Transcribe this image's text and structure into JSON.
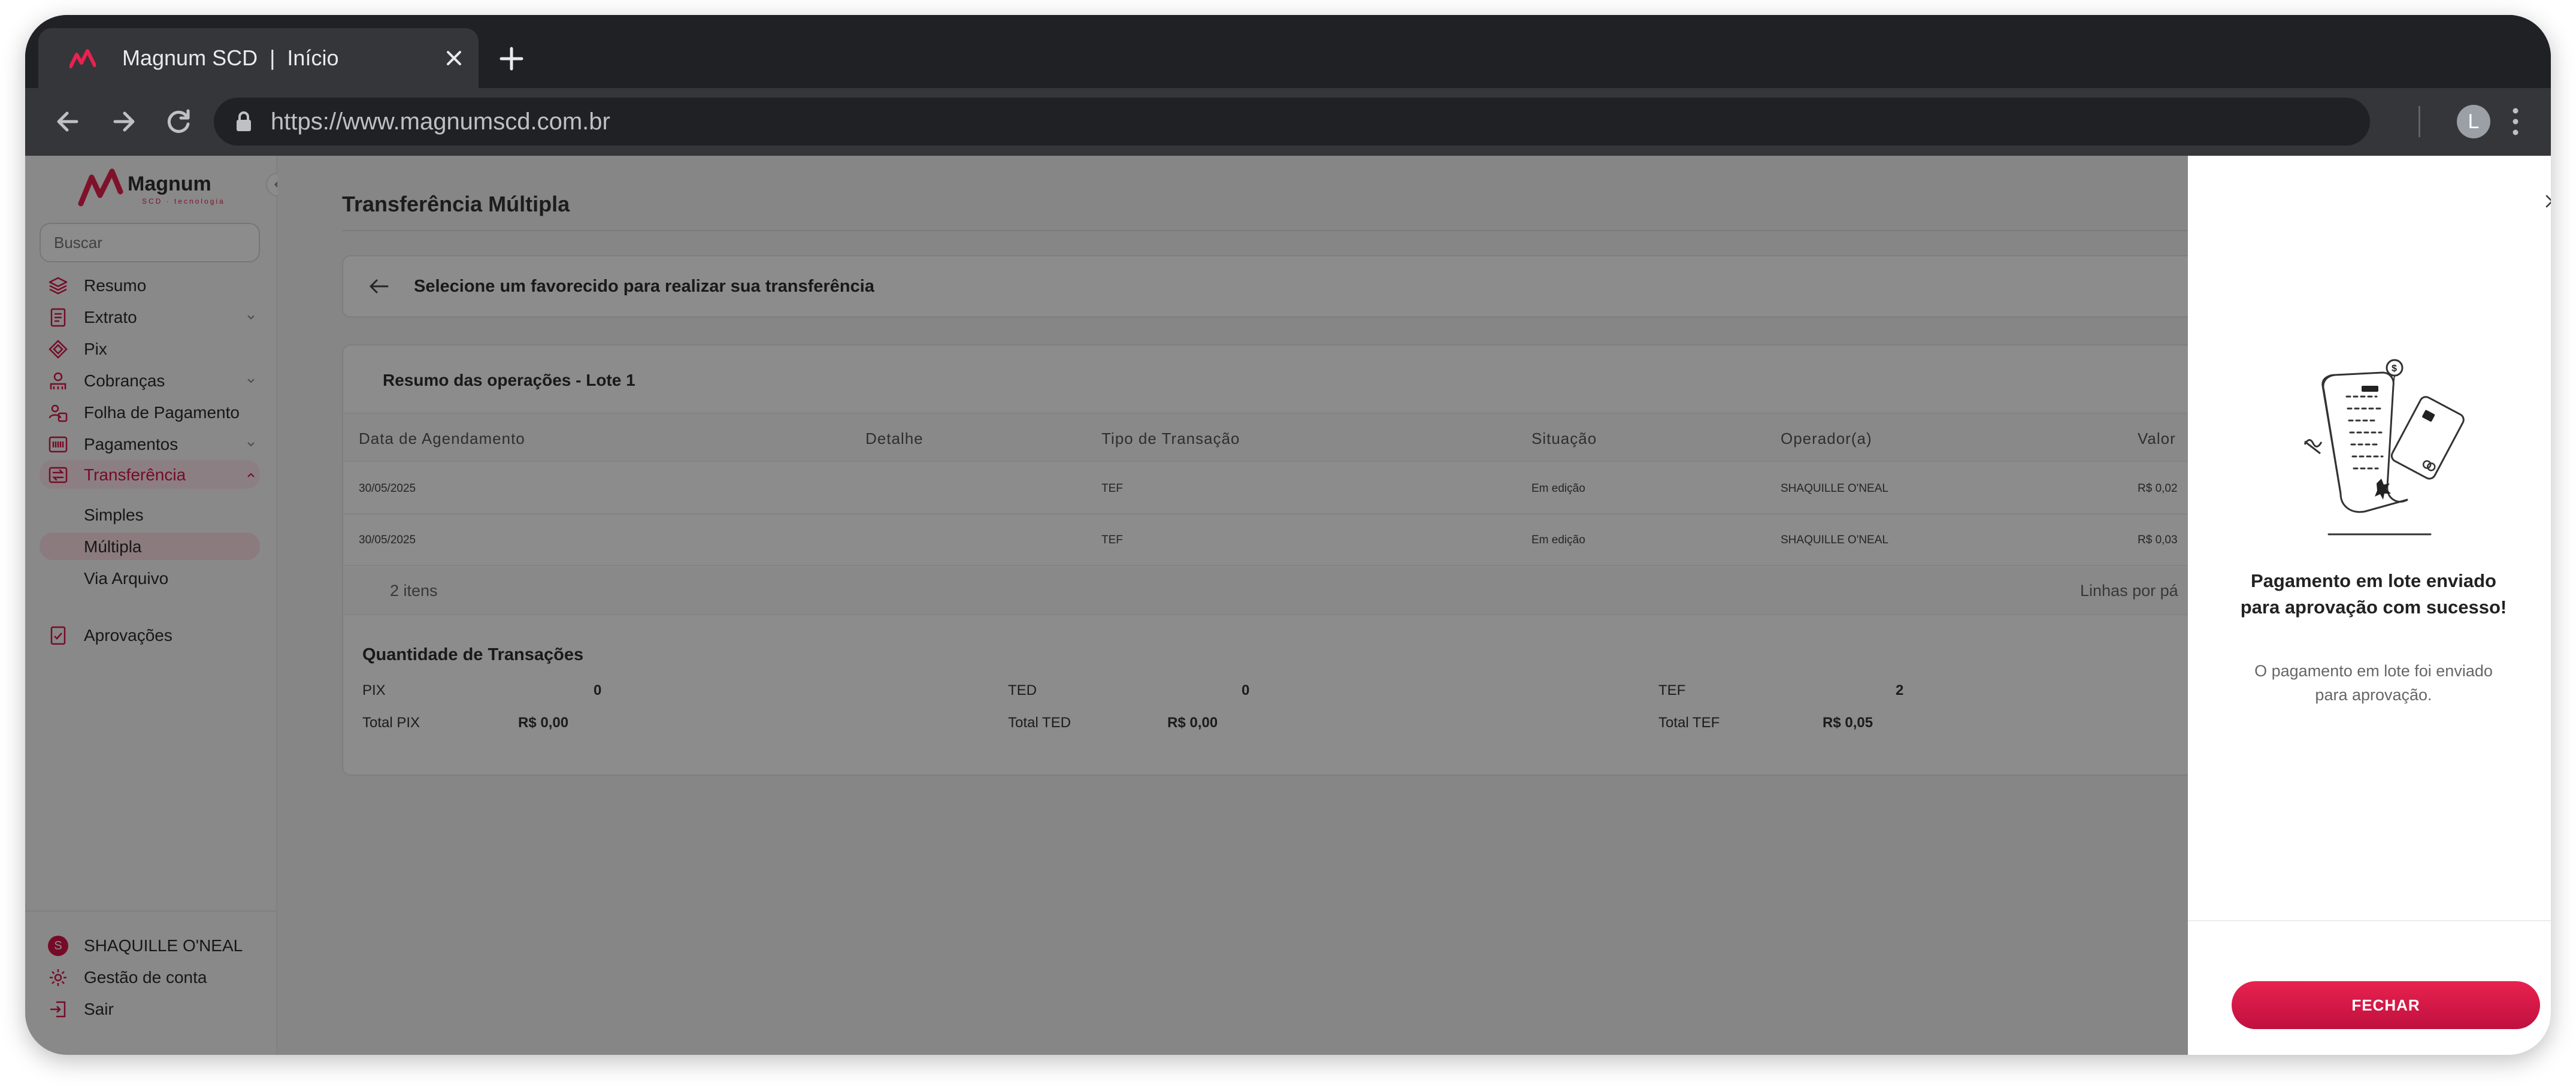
{
  "browser": {
    "tab_title": "Magnum SCD  |  Início",
    "url": "https://www.magnumscd.com.br",
    "profile_initial": "L"
  },
  "sidebar": {
    "logo_text": "Magnum",
    "logo_subtext": "SCD · tecnologia",
    "search_placeholder": "Buscar",
    "items": [
      {
        "label": "Resumo",
        "icon": "layers-icon"
      },
      {
        "label": "Extrato",
        "icon": "document-icon",
        "has_chevron": true
      },
      {
        "label": "Pix",
        "icon": "pix-icon"
      },
      {
        "label": "Cobranças",
        "icon": "barcode-icon",
        "has_chevron": true
      },
      {
        "label": "Folha de Pagamento",
        "icon": "payroll-icon"
      },
      {
        "label": "Pagamentos",
        "icon": "payments-icon",
        "has_chevron": true
      },
      {
        "label": "Transferência",
        "icon": "transfer-icon",
        "has_chevron": true,
        "active": true
      }
    ],
    "subitems": [
      {
        "label": "Simples"
      },
      {
        "label": "Múltipla",
        "active": true
      },
      {
        "label": "Via Arquivo"
      }
    ],
    "approvals": "Aprovações",
    "user": {
      "initial": "S",
      "name": "SHAQUILLE O'NEAL"
    },
    "account": "Gestão de conta",
    "logout": "Sair"
  },
  "main": {
    "page_title": "Transferência Múltipla",
    "select_prompt": "Selecione um favorecido para realizar sua transferência",
    "summary_title": "Resumo das operações - Lote 1",
    "columns": [
      "Data de Agendamento",
      "Detalhe",
      "Tipo de Transação",
      "Situação",
      "Operador(a)",
      "Valor"
    ],
    "rows": [
      {
        "date": "30/05/2025",
        "detail": "",
        "type": "TEF",
        "status": "Em edição",
        "operator": "SHAQUILLE O'NEAL",
        "value": "R$ 0,02"
      },
      {
        "date": "30/05/2025",
        "detail": "",
        "type": "TEF",
        "status": "Em edição",
        "operator": "SHAQUILLE O'NEAL",
        "value": "R$ 0,03"
      }
    ],
    "count": "2 itens",
    "rows_per_page": "Linhas por pá",
    "quantity_title": "Quantidade de Transações",
    "quantities": {
      "pix_label": "PIX",
      "pix_count": "0",
      "pix_total_label": "Total PIX",
      "pix_total": "R$ 0,00",
      "ted_label": "TED",
      "ted_count": "0",
      "ted_total_label": "Total TED",
      "ted_total": "R$ 0,00",
      "tef_label": "TEF",
      "tef_count": "2",
      "tef_total_label": "Total TEF",
      "tef_total": "R$ 0,05"
    }
  },
  "drawer": {
    "title": "Pagamento em lote enviado para aprovação com sucesso!",
    "message": "O pagamento em lote foi enviado para aprovação.",
    "button": "FECHAR"
  },
  "colors": {
    "accent": "#d8154a",
    "button_gradient_top": "#e8224f",
    "button_gradient_bottom": "#c0103e"
  }
}
